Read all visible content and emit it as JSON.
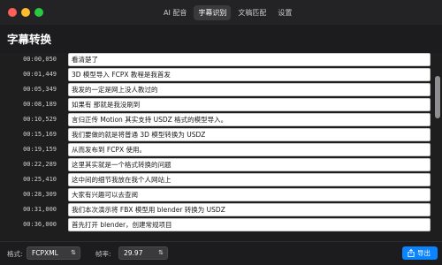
{
  "window": {
    "controls": [
      "close",
      "minimize",
      "zoom"
    ]
  },
  "tabs": [
    {
      "label": "AI 配音",
      "active": false
    },
    {
      "label": "字幕识别",
      "active": true
    },
    {
      "label": "文稿匹配",
      "active": false
    },
    {
      "label": "设置",
      "active": false
    }
  ],
  "page_title": "字幕转换",
  "subtitles": [
    {
      "time": "00:00,050",
      "text": "看清楚了"
    },
    {
      "time": "00:01,449",
      "text": "3D 模型导入 FCPX 教程是我首发"
    },
    {
      "time": "00:05,349",
      "text": "我发的一定是网上没人教过的"
    },
    {
      "time": "00:08,189",
      "text": "如果有 那就是我没刷到"
    },
    {
      "time": "00:10,529",
      "text": "言归正传 Motion 其实支持 USDZ 格式的模型导入。"
    },
    {
      "time": "00:15,169",
      "text": "我们要做的就是将普通 3D 模型转换为 USDZ"
    },
    {
      "time": "00:19,159",
      "text": "从而发布到 FCPX 使用。"
    },
    {
      "time": "00:22,289",
      "text": "这里其实就是一个格式转换的问题"
    },
    {
      "time": "00:25,410",
      "text": "这中间的细节我放在我个人网站上"
    },
    {
      "time": "00:28,309",
      "text": "大家有兴趣可以去查阅"
    },
    {
      "time": "00:31,000",
      "text": "我们本次演示将 FBX 模型用 blender 转换为 USDZ"
    },
    {
      "time": "00:36,000",
      "text": "首先打开 blender，创建常规项目"
    }
  ],
  "footer": {
    "format_label": "格式:",
    "format_value": "FCPXML",
    "fps_label": "帧率:",
    "fps_value": "29.97",
    "export_label": "导出",
    "export_icon": "share-icon"
  },
  "colors": {
    "accent": "#0a84ff",
    "close": "#fe5f57",
    "minimize": "#febc2e",
    "zoom": "#28c840"
  }
}
